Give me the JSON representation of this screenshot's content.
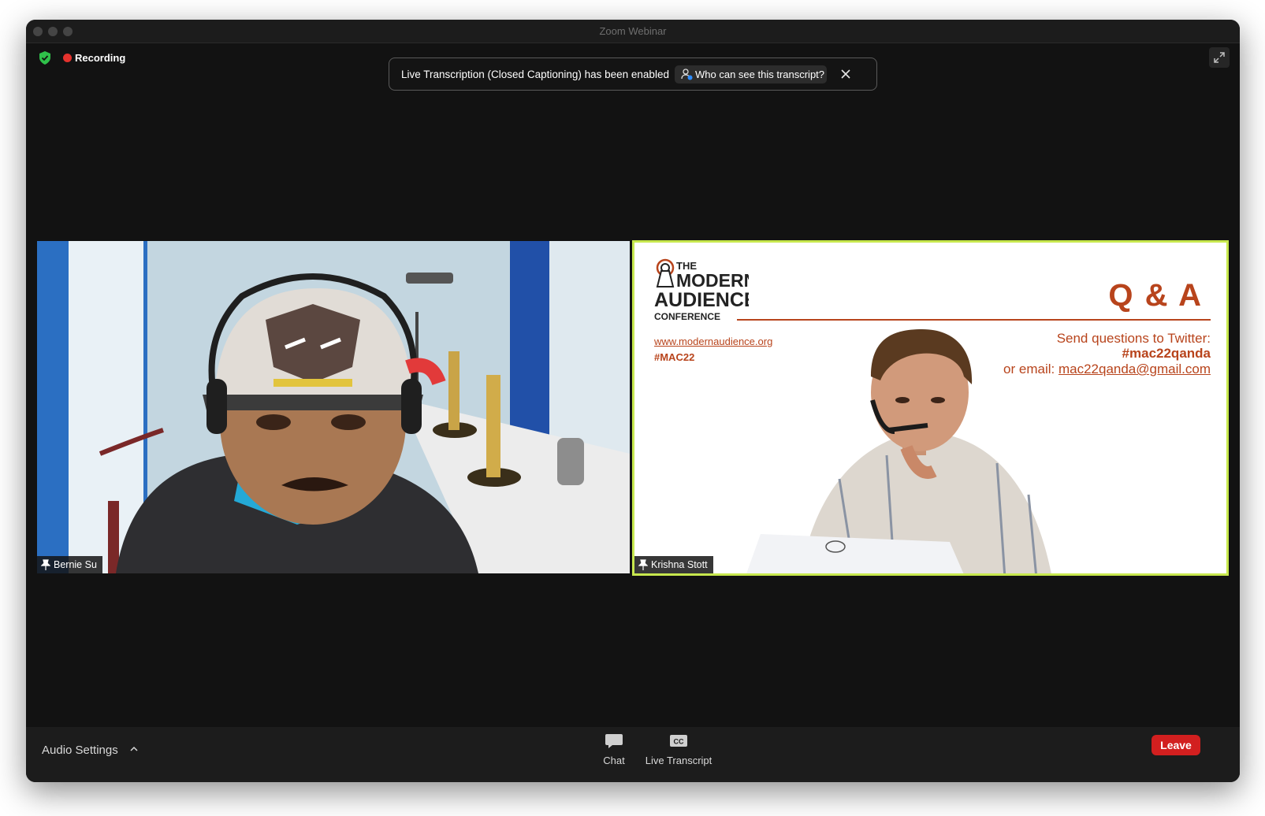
{
  "window": {
    "title": "Zoom Webinar"
  },
  "status": {
    "recording_label": "Recording",
    "shield_icon": "shield-check-icon",
    "shield_color": "#2fc14a",
    "recording_color": "#e5322d"
  },
  "notice": {
    "text": "Live Transcription (Closed Captioning) has been enabled",
    "who_button": "Who can see this transcript?"
  },
  "participants": [
    {
      "name": "Bernie Su",
      "pinned": true,
      "active_speaker": false
    },
    {
      "name": "Krishna Stott",
      "pinned": true,
      "active_speaker": true
    }
  ],
  "slide": {
    "logo_lines": [
      "THE",
      "MODERN",
      "AUDIENCE",
      "CONFERENCE"
    ],
    "title": "Q & A",
    "website": "www.modernaudience.org",
    "hashtag": "#MAC22",
    "send_questions": "Send questions to Twitter:",
    "twitter_tag": "#mac22qanda",
    "email_prefix": "or email:",
    "email": "mac22qanda@gmail.com",
    "accent_color": "#b8441c"
  },
  "toolbar": {
    "audio_settings": "Audio Settings",
    "chat_label": "Chat",
    "live_transcript_label": "Live Transcript",
    "cc_glyph": "CC",
    "leave_label": "Leave",
    "leave_color": "#d21f1f"
  },
  "colors": {
    "active_speaker_border": "#c7e84e",
    "background": "#121212"
  }
}
